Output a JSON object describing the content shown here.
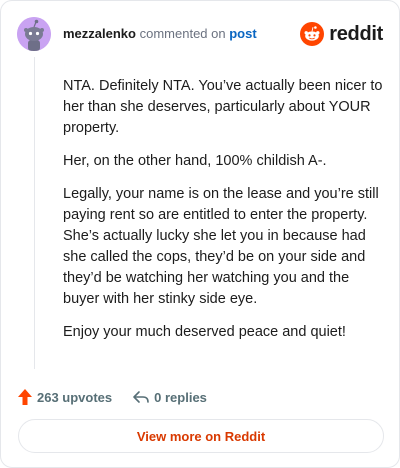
{
  "header": {
    "username": "mezzalenko",
    "action_text": "commented on",
    "post_link_label": "post",
    "avatar_icon": "snoo-avatar-icon",
    "brand": {
      "logo_text": "reddit",
      "icon": "reddit-snoo-icon",
      "color": "#ff4500"
    }
  },
  "comment": {
    "paragraphs": [
      "NTA. Definitely NTA. You’ve actually been nicer to her than she deserves, particularly about YOUR property.",
      "Her, on the other hand, 100% childish A-.",
      "Legally, your name is on the lease and you’re still paying rent so are entitled to enter the property. She’s actually lucky she let you in because had she called the cops, they’d be on your side and they’d be watching her watching you and the buyer with her stinky side eye.",
      "Enjoy your much deserved peace and quiet!"
    ]
  },
  "stats": {
    "upvotes": "263 upvotes",
    "upvote_icon": "upvote-arrow-icon",
    "upvote_color": "#ff4500",
    "replies": "0 replies",
    "reply_icon": "reply-arrow-icon"
  },
  "actions": {
    "view_more": "View more on Reddit",
    "view_more_color": "#d93900"
  }
}
